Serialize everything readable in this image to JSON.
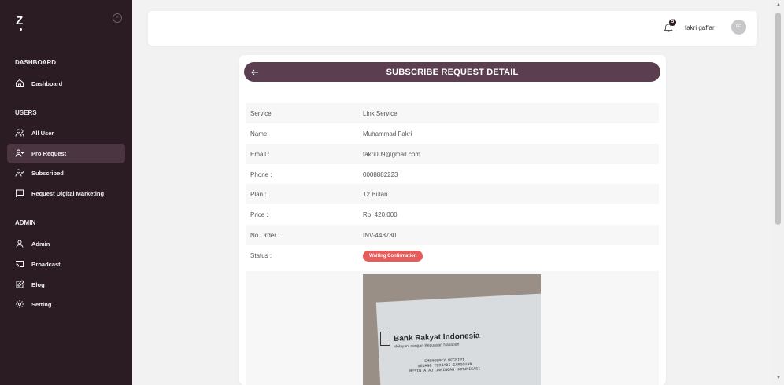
{
  "sidebar": {
    "logo": "Z",
    "collapse_icon": "close-circle-icon",
    "sections": [
      {
        "title": "DASHBOARD",
        "items": [
          {
            "label": "Dashboard",
            "icon": "home-icon"
          }
        ]
      },
      {
        "title": "USERS",
        "items": [
          {
            "label": "All User",
            "icon": "users-icon"
          },
          {
            "label": "Pro Request",
            "icon": "user-plus-icon",
            "active": true
          },
          {
            "label": "Subscribed",
            "icon": "user-check-icon"
          },
          {
            "label": "Request Digital Marketing",
            "icon": "message-square-icon"
          }
        ]
      },
      {
        "title": "ADMIN",
        "items": [
          {
            "label": "Admin",
            "icon": "user-icon"
          },
          {
            "label": "Broadcast",
            "icon": "cast-icon"
          },
          {
            "label": "Blog",
            "icon": "edit-icon"
          },
          {
            "label": "Setting",
            "icon": "gear-icon"
          }
        ]
      }
    ]
  },
  "header": {
    "notification_count": "5",
    "user_name": "fakri gaffar",
    "avatar_initials": "FG"
  },
  "detail": {
    "title": "SUBSCRIBE REQUEST DETAIL",
    "rows": [
      {
        "label": "Service",
        "value": "Link Service"
      },
      {
        "label": "Name",
        "value": "Muhammad Fakri"
      },
      {
        "label": "Email :",
        "value": "fakri009@gmail.com"
      },
      {
        "label": "Phone :",
        "value": "0008882223"
      },
      {
        "label": "Plan :",
        "value": "12 Bulan"
      },
      {
        "label": "Price :",
        "value": "Rp. 420.000"
      },
      {
        "label": "No Order :",
        "value": "INV-448730"
      },
      {
        "label": "Status :",
        "value": "Waiting Confirmation"
      }
    ],
    "status_color": "#e85b5b",
    "receipt": {
      "bank_name": "Bank Rakyat Indonesia",
      "bank_tagline": "Melayani dengan Kepuasan Nasabah",
      "lines": [
        "EMERGENCY RECEIPT",
        "SEDANG TERJADI GANGGUAN",
        "MESIN ATAU JARINGAN KOMUNIKASI"
      ]
    }
  },
  "colors": {
    "sidebar_bg": "#2b1c24",
    "header_pill": "#5b3f50"
  }
}
